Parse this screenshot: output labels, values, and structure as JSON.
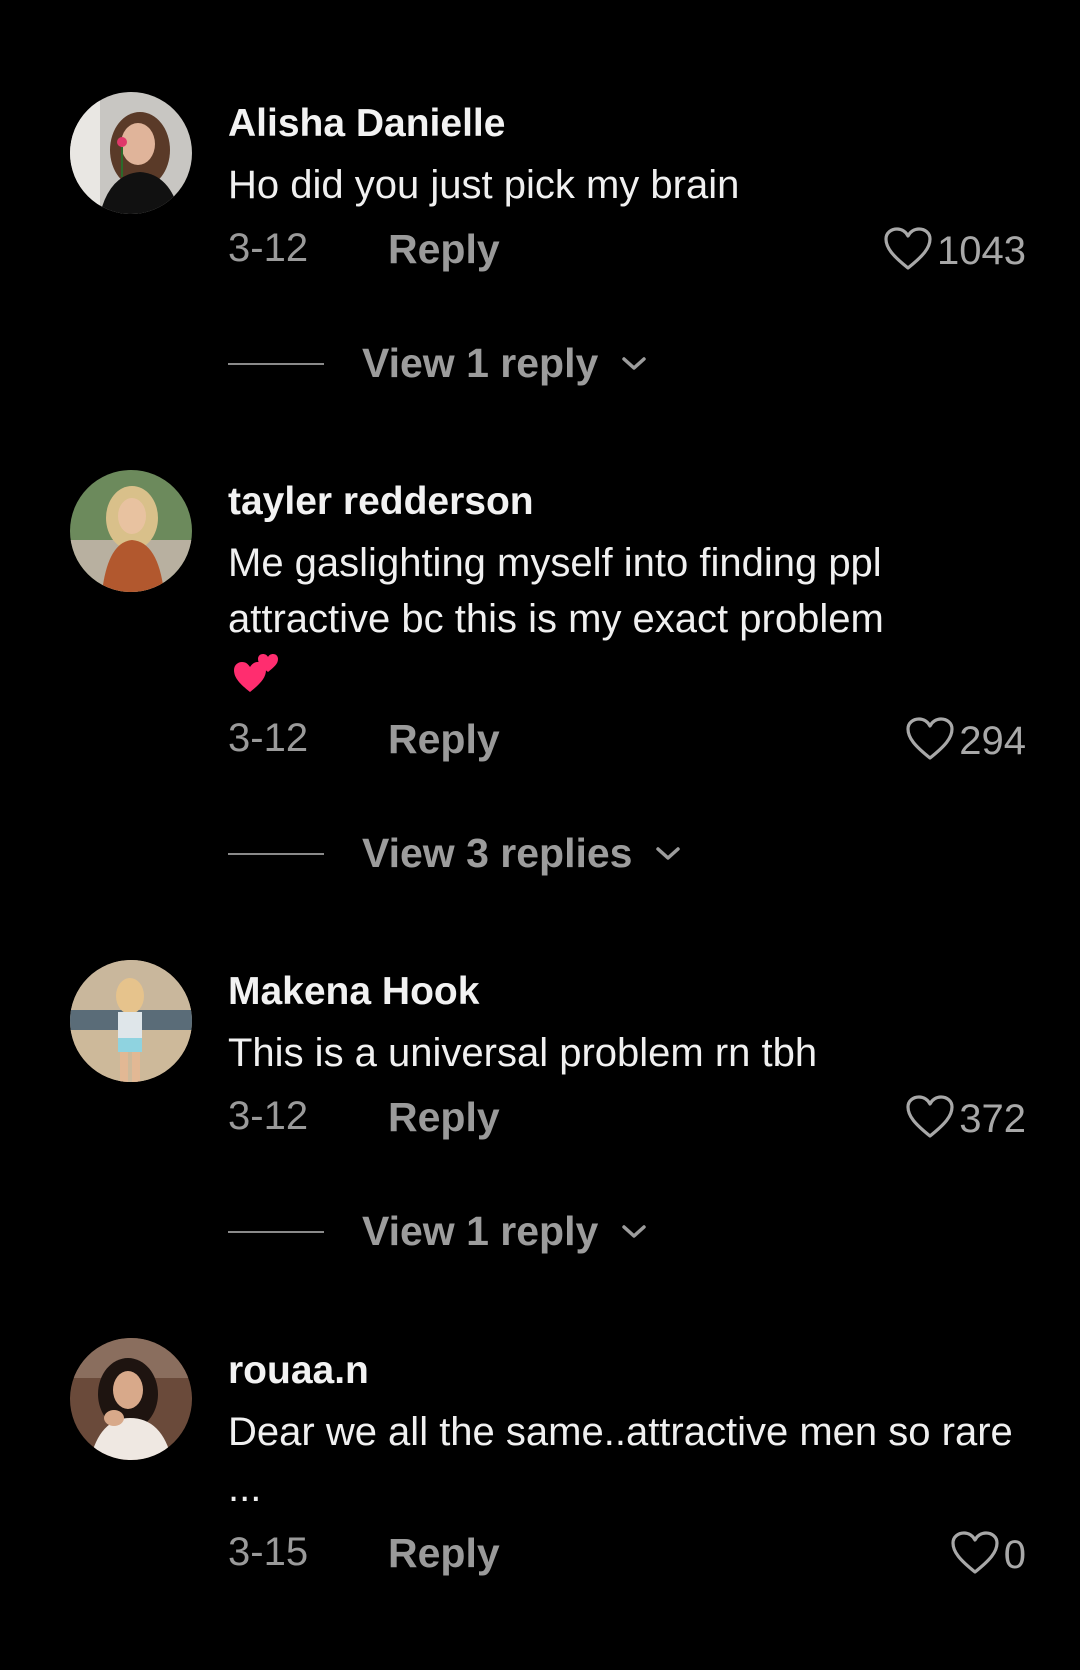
{
  "colors": {
    "background": "#000000",
    "username": "#f2f2f2",
    "body_text": "#f0f0f0",
    "muted": "#9a9a9a",
    "emoji_heart": "#ff2d6f"
  },
  "comments": [
    {
      "username": "Alisha Danielle",
      "text": "Ho did you just pick my brain",
      "date": "3-12",
      "reply_label": "Reply",
      "likes": "1043",
      "view_replies": "View 1 reply"
    },
    {
      "username": "tayler redderson",
      "text": "Me gaslighting myself into finding ppl attractive bc this is my exact problem",
      "emoji": "two-hearts",
      "date": "3-12",
      "reply_label": "Reply",
      "likes": "294",
      "view_replies": "View 3 replies"
    },
    {
      "username": "Makena Hook",
      "text": "This is a universal problem rn tbh",
      "date": "3-12",
      "reply_label": "Reply",
      "likes": "372",
      "view_replies": "View 1 reply"
    },
    {
      "username": "rouaa.n",
      "text": "Dear we all the same..attractive men so rare ...",
      "date": "3-15",
      "reply_label": "Reply",
      "likes": "0"
    }
  ]
}
